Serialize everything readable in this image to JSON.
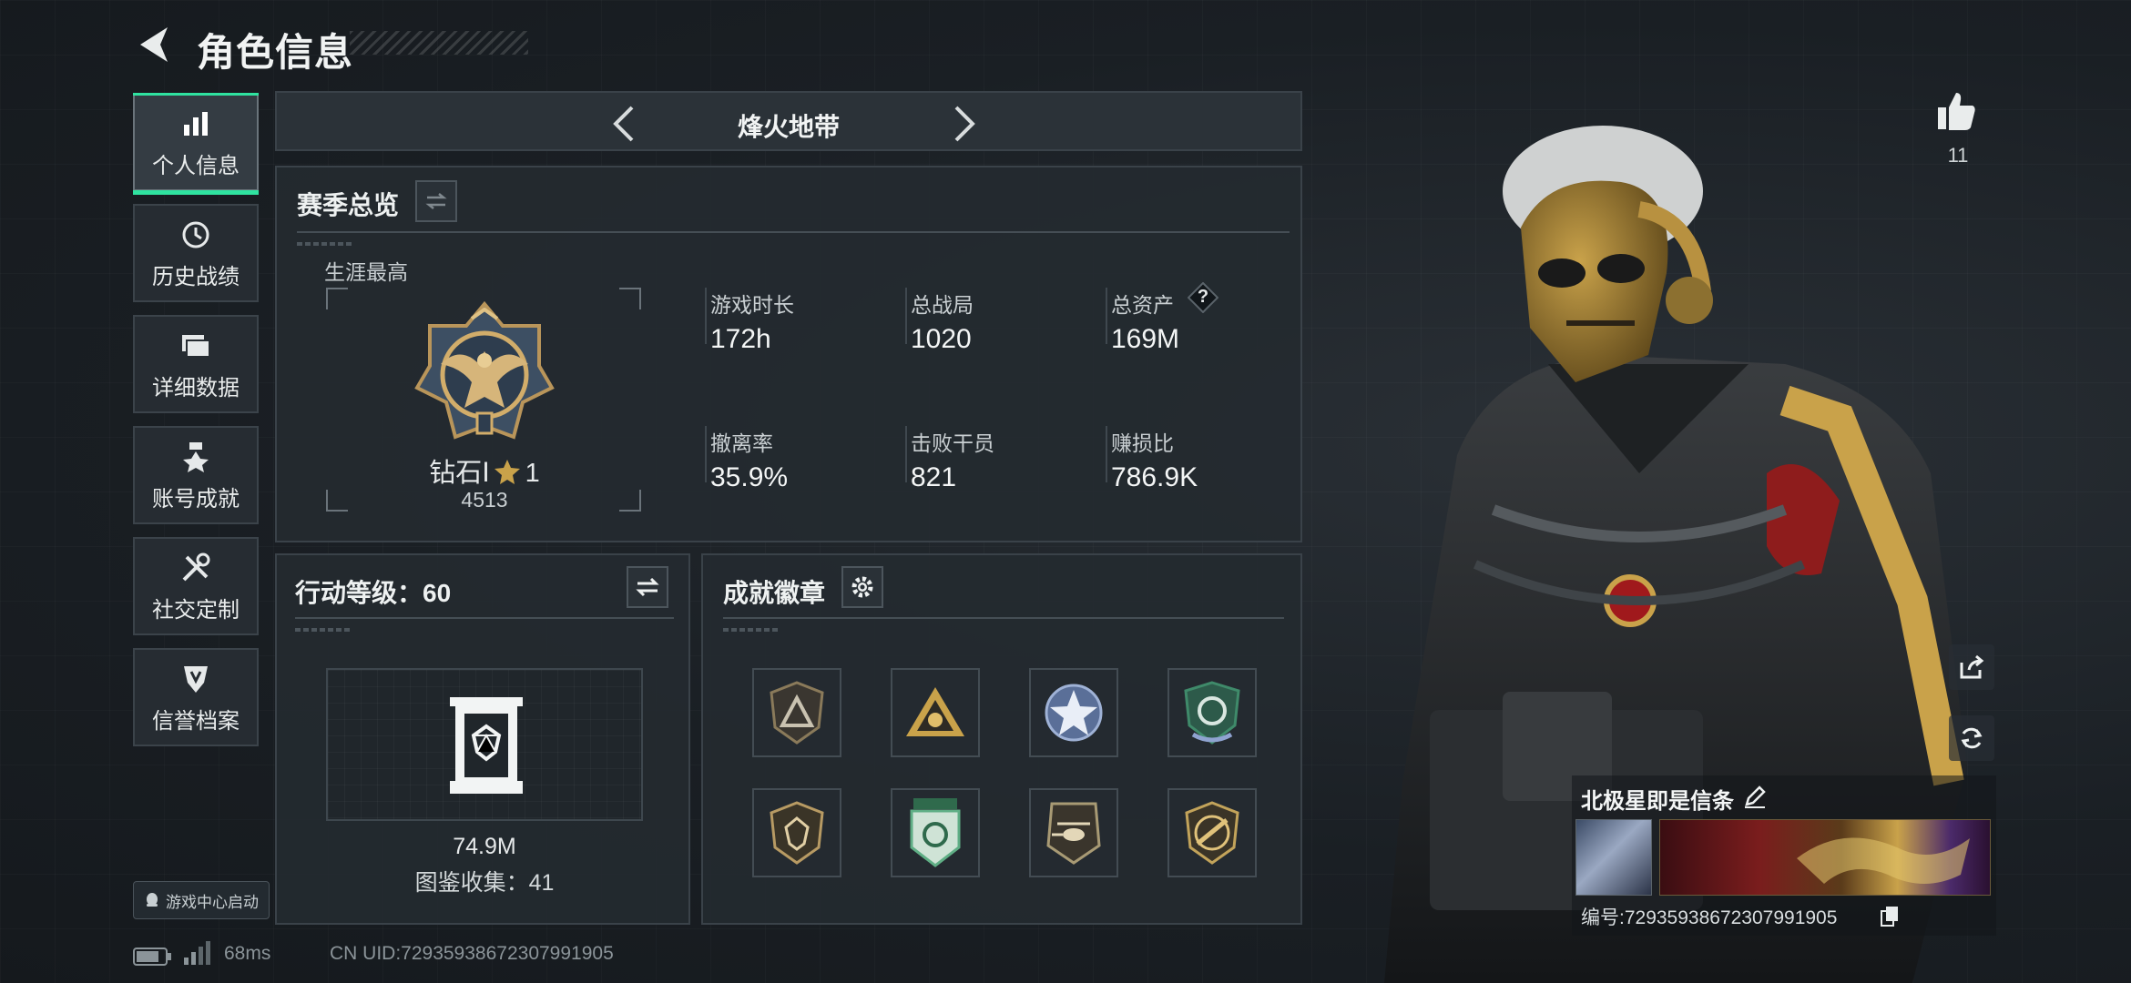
{
  "header": {
    "title": "角色信息"
  },
  "nav": {
    "items": [
      {
        "label": "个人信息",
        "icon": "bar-chart-icon",
        "active": true
      },
      {
        "label": "历史战绩",
        "icon": "history-clock-icon"
      },
      {
        "label": "详细数据",
        "icon": "folder-icon"
      },
      {
        "label": "账号成就",
        "icon": "medal-icon"
      },
      {
        "label": "社交定制",
        "icon": "tools-icon"
      },
      {
        "label": "信誉档案",
        "icon": "shield-icon"
      }
    ],
    "game_center": "游戏中心启动"
  },
  "mode": {
    "name": "烽火地带"
  },
  "season": {
    "title": "赛季总览",
    "career_label": "生涯最高",
    "rank_name": "钻石Ⅰ",
    "rank_stars": "1",
    "rank_points": "4513",
    "stats": [
      {
        "label": "游戏时长",
        "value": "172h"
      },
      {
        "label": "总战局",
        "value": "1020"
      },
      {
        "label": "总资产",
        "value": "169M",
        "help": "?"
      },
      {
        "label": "撤离率",
        "value": "35.9%"
      },
      {
        "label": "击败干员",
        "value": "821"
      },
      {
        "label": "赚损比",
        "value": "786.9K"
      }
    ]
  },
  "action_level": {
    "title": "行动等级：60",
    "value": "74.9M",
    "collection": "图鉴收集：41"
  },
  "badges": {
    "title": "成就徽章",
    "items": [
      {
        "icon": "triangle-badge-icon",
        "color": "#8a7a5a"
      },
      {
        "icon": "gold-pyramid-badge-icon",
        "color": "#c9a24a"
      },
      {
        "icon": "star-emblem-badge-icon",
        "color": "#9fb2d6"
      },
      {
        "icon": "green-shield-badge-icon",
        "color": "#3f8a6a"
      },
      {
        "icon": "diamond-shield-badge-icon",
        "color": "#b79a63"
      },
      {
        "icon": "green-crest-badge-icon",
        "color": "#5fae85"
      },
      {
        "icon": "helicopter-badge-icon",
        "color": "#a89a74"
      },
      {
        "icon": "gold-rifle-badge-icon",
        "color": "#c2a35a"
      }
    ]
  },
  "profile": {
    "likes": "11",
    "player_name": "北极星即是信条",
    "id_label": "编号:7293593867230799​1905"
  },
  "status": {
    "ping": "68ms",
    "uid": "CN UID:7293593867230799​1905"
  },
  "colors": {
    "accent": "#2fe3a0",
    "gold": "#c9a24a"
  }
}
